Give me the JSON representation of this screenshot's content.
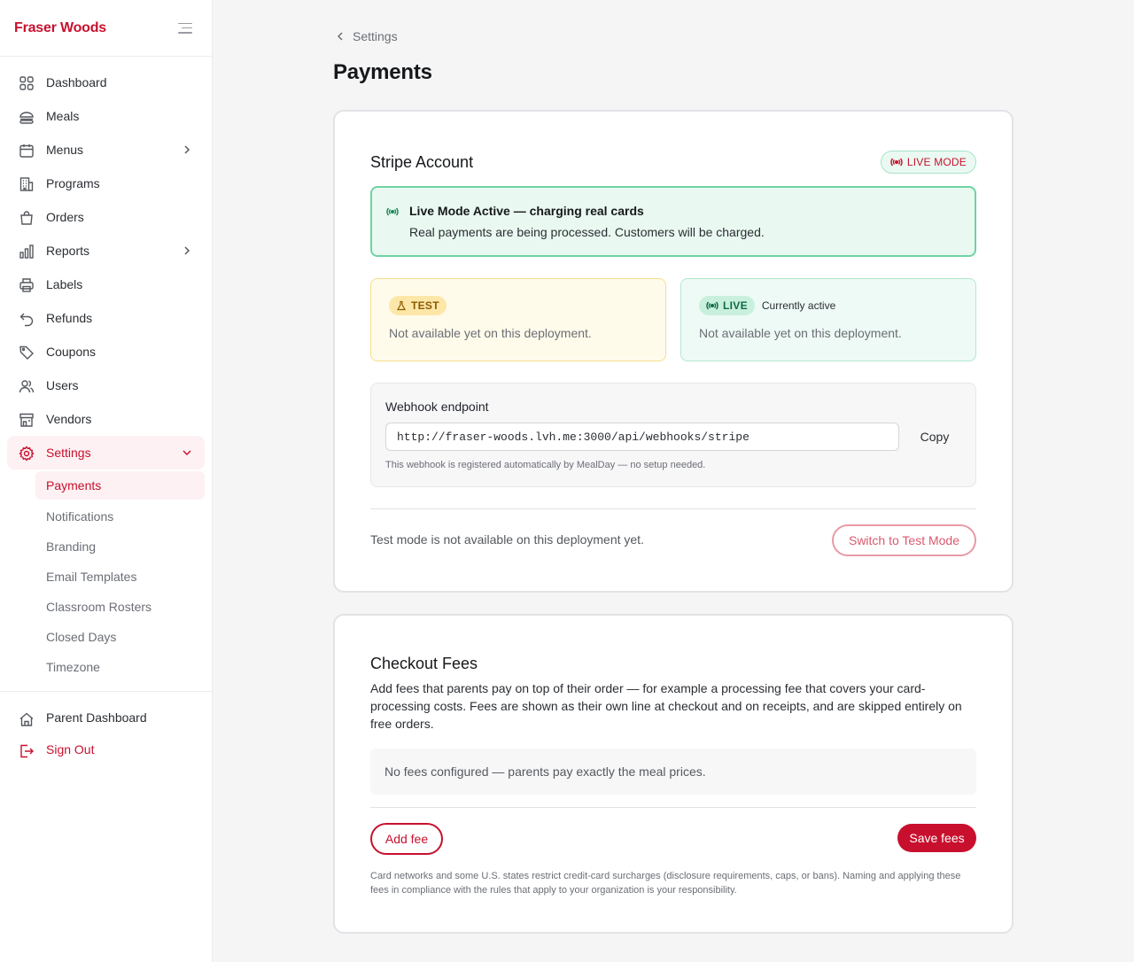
{
  "sidebar": {
    "brand": "Fraser Woods",
    "nav": [
      {
        "label": "Dashboard"
      },
      {
        "label": "Meals"
      },
      {
        "label": "Menus"
      },
      {
        "label": "Programs"
      },
      {
        "label": "Orders"
      },
      {
        "label": "Reports"
      },
      {
        "label": "Labels"
      },
      {
        "label": "Refunds"
      },
      {
        "label": "Coupons"
      },
      {
        "label": "Users"
      },
      {
        "label": "Vendors"
      },
      {
        "label": "Settings"
      }
    ],
    "settings_sub": [
      {
        "label": "Payments"
      },
      {
        "label": "Notifications"
      },
      {
        "label": "Branding"
      },
      {
        "label": "Email Templates"
      },
      {
        "label": "Classroom Rosters"
      },
      {
        "label": "Closed Days"
      },
      {
        "label": "Timezone"
      }
    ],
    "bottom": [
      {
        "label": "Parent Dashboard"
      },
      {
        "label": "Sign Out"
      }
    ]
  },
  "header": {
    "breadcrumb": "Settings",
    "title": "Payments"
  },
  "stripe": {
    "title": "Stripe Account",
    "mode_badge": "LIVE MODE",
    "alert": {
      "title": "Live Mode Active — charging real cards",
      "text": "Real payments are being processed. Customers will be charged."
    },
    "test_card": {
      "tag": "TEST",
      "text": "Not available yet on this deployment."
    },
    "live_card": {
      "tag": "LIVE",
      "status": "Currently active",
      "text": "Not available yet on this deployment."
    },
    "webhook": {
      "label": "Webhook endpoint",
      "url": "http://fraser-woods.lvh.me:3000/api/webhooks/stripe",
      "copy_label": "Copy",
      "note": "This webhook is registered automatically by MealDay — no setup needed."
    },
    "test_note": "Test mode is not available on this deployment yet.",
    "switch_label": "Switch to Test Mode"
  },
  "fees": {
    "title": "Checkout Fees",
    "description": "Add fees that parents pay on top of their order — for example a processing fee that covers your card-processing costs. Fees are shown as their own line at checkout and on receipts, and are skipped entirely on free orders.",
    "empty": "No fees configured — parents pay exactly the meal prices.",
    "add_label": "Add fee",
    "save_label": "Save fees",
    "legal": "Card networks and some U.S. states restrict credit-card surcharges (disclosure requirements, caps, or bans). Naming and applying these fees in compliance with the rules that apply to your organization is your responsibility."
  },
  "colors": {
    "brand": "#c8102e",
    "live_green": "#6fd3a3",
    "test_yellow": "#f6dd8c"
  },
  "icons": [
    "dashboard-icon",
    "meals-icon",
    "calendar-icon",
    "building-icon",
    "bag-icon",
    "chart-icon",
    "printer-icon",
    "refund-icon",
    "tag-icon",
    "users-icon",
    "store-icon",
    "gear-icon",
    "home-icon",
    "sign-out-icon",
    "radio-waves-icon",
    "flask-icon",
    "chevron-right-icon",
    "chevron-down-icon",
    "chevron-left-icon",
    "menu-toggle-icon"
  ]
}
